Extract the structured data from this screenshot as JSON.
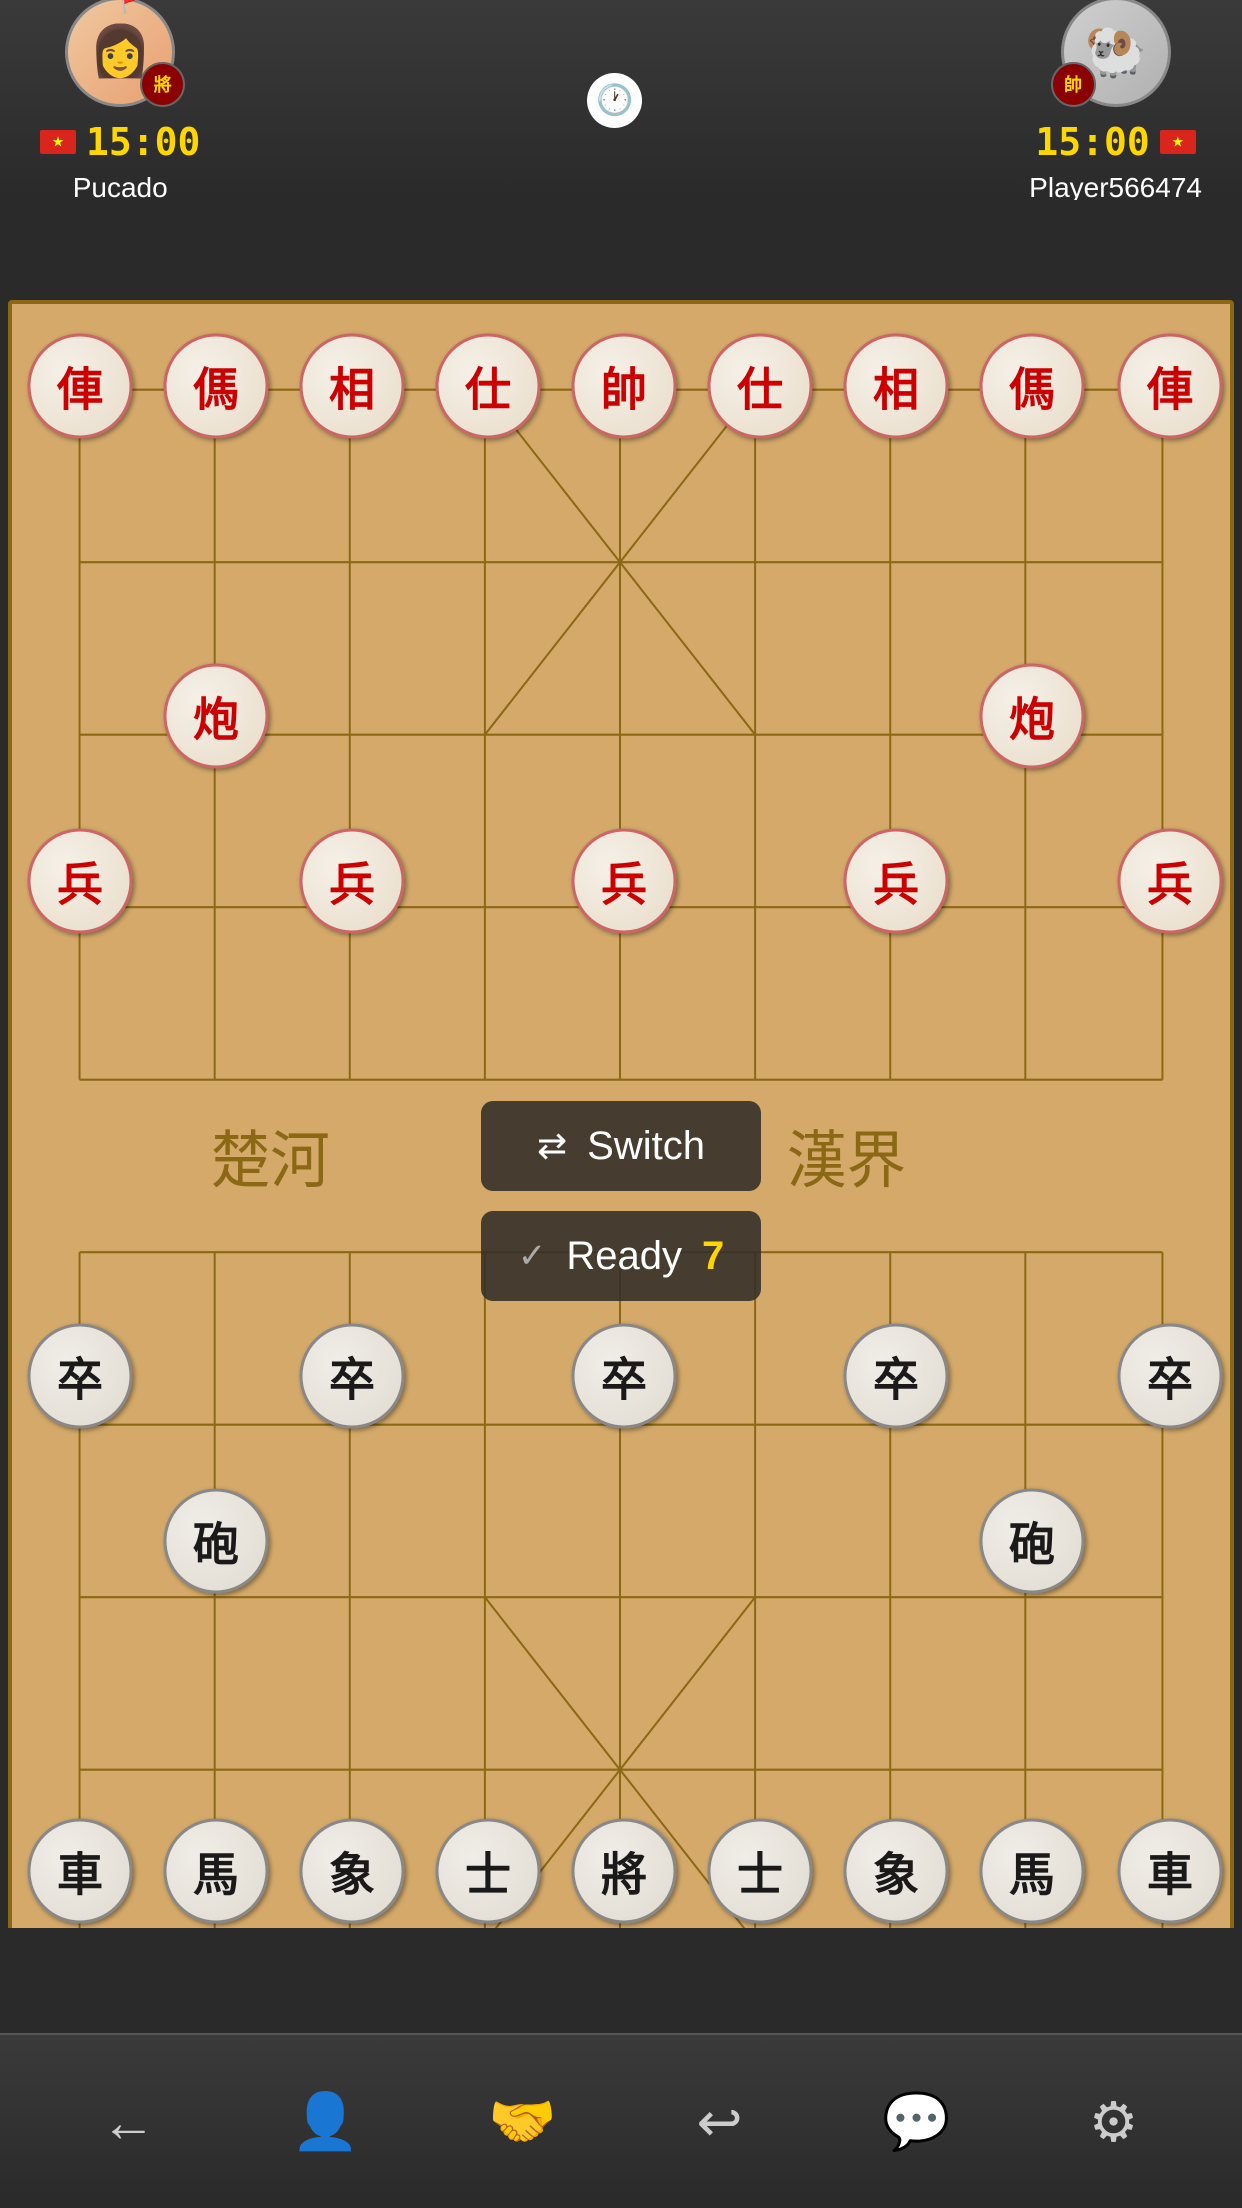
{
  "header": {
    "player1": {
      "name": "Pucado",
      "avatar_emoji": "👩",
      "rank_char": "將",
      "timer": "15:00"
    },
    "player2": {
      "name": "Player566474",
      "avatar_emoji": "🐏",
      "rank_char": "帥",
      "timer": "15:00"
    },
    "clock_icon": "🕐"
  },
  "board": {
    "pieces_red": [
      {
        "char": "俥",
        "col": 0,
        "row": 0
      },
      {
        "char": "傌",
        "col": 1,
        "row": 0
      },
      {
        "char": "相",
        "col": 2,
        "row": 0
      },
      {
        "char": "仕",
        "col": 3,
        "row": 0
      },
      {
        "char": "帥",
        "col": 4,
        "row": 0
      },
      {
        "char": "仕",
        "col": 5,
        "row": 0
      },
      {
        "char": "相",
        "col": 6,
        "row": 0
      },
      {
        "char": "傌",
        "col": 7,
        "row": 0
      },
      {
        "char": "俥",
        "col": 8,
        "row": 0
      },
      {
        "char": "炮",
        "col": 1,
        "row": 2
      },
      {
        "char": "炮",
        "col": 7,
        "row": 2
      },
      {
        "char": "兵",
        "col": 0,
        "row": 4
      },
      {
        "char": "兵",
        "col": 2,
        "row": 4
      },
      {
        "char": "兵",
        "col": 4,
        "row": 4
      },
      {
        "char": "兵",
        "col": 6,
        "row": 4
      },
      {
        "char": "兵",
        "col": 8,
        "row": 4
      }
    ],
    "pieces_black": [
      {
        "char": "卒",
        "col": 0,
        "row": 6
      },
      {
        "char": "卒",
        "col": 2,
        "row": 6
      },
      {
        "char": "卒",
        "col": 4,
        "row": 6
      },
      {
        "char": "卒",
        "col": 6,
        "row": 6
      },
      {
        "char": "卒",
        "col": 8,
        "row": 6
      },
      {
        "char": "砲",
        "col": 1,
        "row": 7
      },
      {
        "char": "砲",
        "col": 7,
        "row": 7
      },
      {
        "char": "車",
        "col": 0,
        "row": 9
      },
      {
        "char": "馬",
        "col": 1,
        "row": 9
      },
      {
        "char": "象",
        "col": 2,
        "row": 9
      },
      {
        "char": "士",
        "col": 3,
        "row": 9
      },
      {
        "char": "將",
        "col": 4,
        "row": 9
      },
      {
        "char": "士",
        "col": 5,
        "row": 9
      },
      {
        "char": "象",
        "col": 6,
        "row": 9
      },
      {
        "char": "馬",
        "col": 7,
        "row": 9
      },
      {
        "char": "車",
        "col": 8,
        "row": 9
      }
    ]
  },
  "overlay": {
    "switch_label": "Switch",
    "switch_icon": "⇄",
    "ready_label": "Ready",
    "ready_number": "7",
    "ready_icon": "✓"
  },
  "toolbar": {
    "back_icon": "←",
    "person_icon": "👤",
    "handshake_icon": "🤝",
    "undo_icon": "↩",
    "chat_icon": "💬",
    "settings_icon": "⚙"
  }
}
